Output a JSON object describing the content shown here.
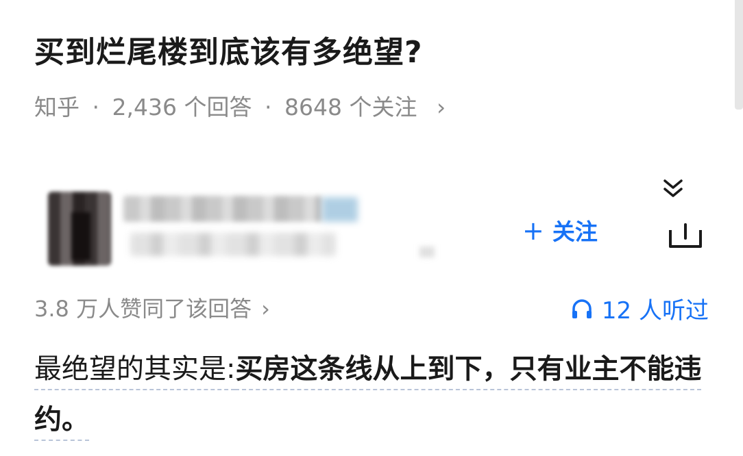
{
  "question": {
    "title": "买到烂尾楼到底该有多绝望?",
    "source": "知乎",
    "sep1": "·",
    "answers_count": "2,436 个回答",
    "sep2": "·",
    "followers_count": "8648 个关注",
    "more_chevron": "›"
  },
  "author": {
    "follow_label": "关注",
    "follow_plus": "+"
  },
  "stats": {
    "upvote_text": "3.8 万人赞同了该回答",
    "upvote_chevron": "›",
    "listen_text": "12 人听过"
  },
  "answer": {
    "part1": "最绝望的其实是:",
    "part2": "买房这条线从上到下，只有业主不能违约。"
  },
  "colors": {
    "accent": "#1772f6",
    "muted": "#8a8a8a",
    "text": "#1a1a1a"
  },
  "icons": {
    "collapse": "double-chevron-down-icon",
    "share": "share-tray-icon",
    "listen": "headphones-icon"
  }
}
